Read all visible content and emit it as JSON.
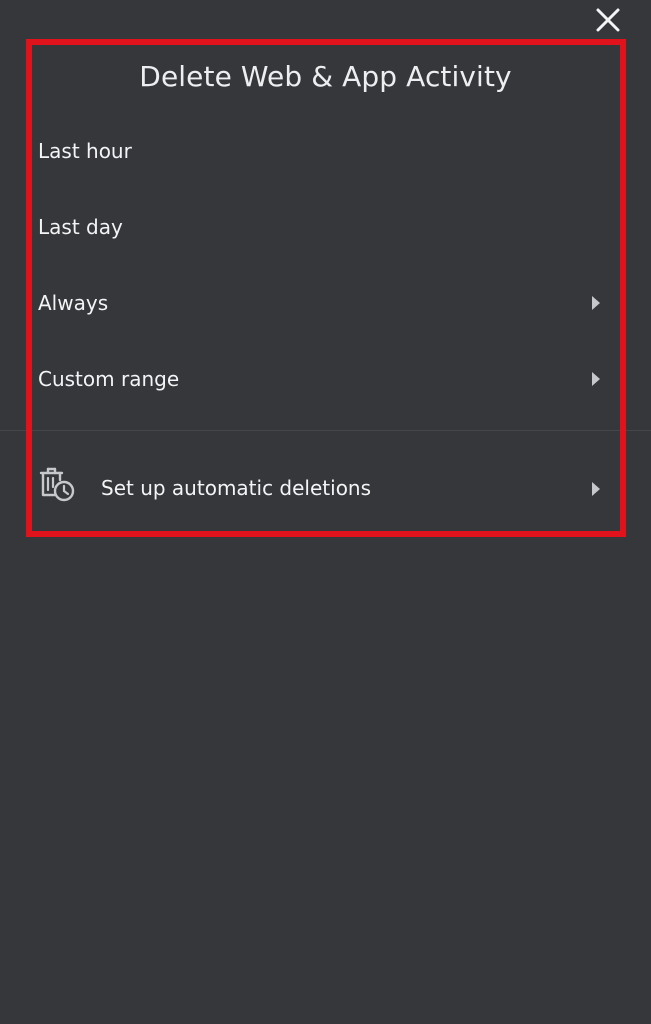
{
  "dialog": {
    "title": "Delete Web & App Activity",
    "close_icon": "close-icon"
  },
  "options": [
    {
      "label": "Last hour",
      "has_chevron": false
    },
    {
      "label": "Last day",
      "has_chevron": false
    },
    {
      "label": "Always",
      "has_chevron": true
    },
    {
      "label": "Custom range",
      "has_chevron": true
    }
  ],
  "automatic": {
    "label": "Set up automatic deletions",
    "icon": "trash-clock-icon",
    "has_chevron": true
  },
  "colors": {
    "background": "#35373a",
    "text": "#f3f4f5",
    "chevron": "#c6c8cb",
    "divider": "#43464a",
    "highlight": "#e0131c"
  }
}
